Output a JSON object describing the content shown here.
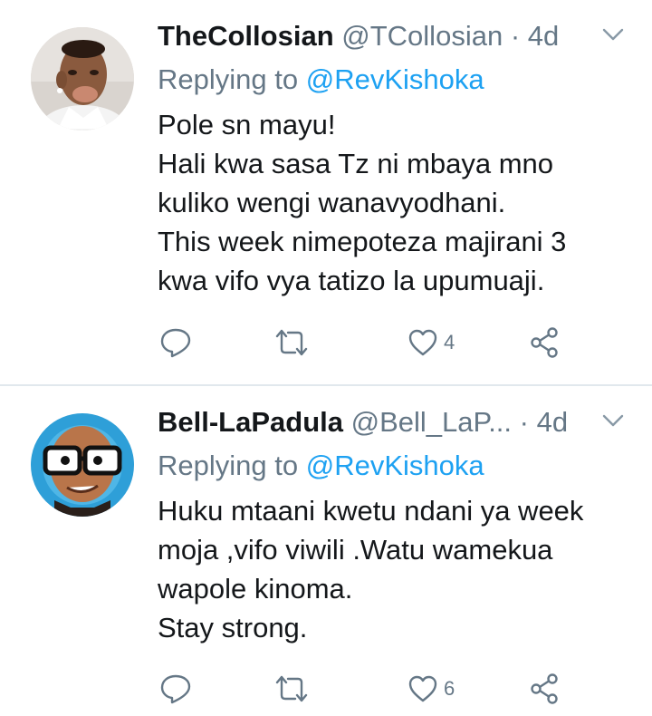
{
  "tweets": [
    {
      "display_name": "TheCollosian",
      "handle": "@TCollosian",
      "separator": "·",
      "time": "4d",
      "replying_prefix": "Replying to",
      "replying_to": "@RevKishoka",
      "lines": [
        "Pole sn mayu!",
        "Hali kwa sasa Tz ni mbaya mno",
        "kuliko wengi wanavyodhani.",
        "This week nimepoteza majirani 3",
        "kwa vifo vya tatizo la upumuaji."
      ],
      "like_count": "4",
      "icons": [
        "reply-icon",
        "retweet-icon",
        "like-icon",
        "share-icon",
        "chevron-down-icon"
      ]
    },
    {
      "display_name": "Bell-LaPadula",
      "handle": "@Bell_LaP...",
      "separator": "·",
      "time": "4d",
      "replying_prefix": "Replying to",
      "replying_to": "@RevKishoka",
      "lines": [
        "Huku mtaani kwetu ndani ya week",
        "moja ,vifo viwili .Watu wamekua",
        "wapole kinoma.",
        "Stay strong."
      ],
      "like_count": "6",
      "icons": [
        "reply-icon",
        "retweet-icon",
        "like-icon",
        "share-icon",
        "chevron-down-icon"
      ]
    }
  ],
  "colors": {
    "text": "#14171a",
    "secondary": "#657786",
    "link": "#1da1f2",
    "divider": "#e1e8ed"
  }
}
